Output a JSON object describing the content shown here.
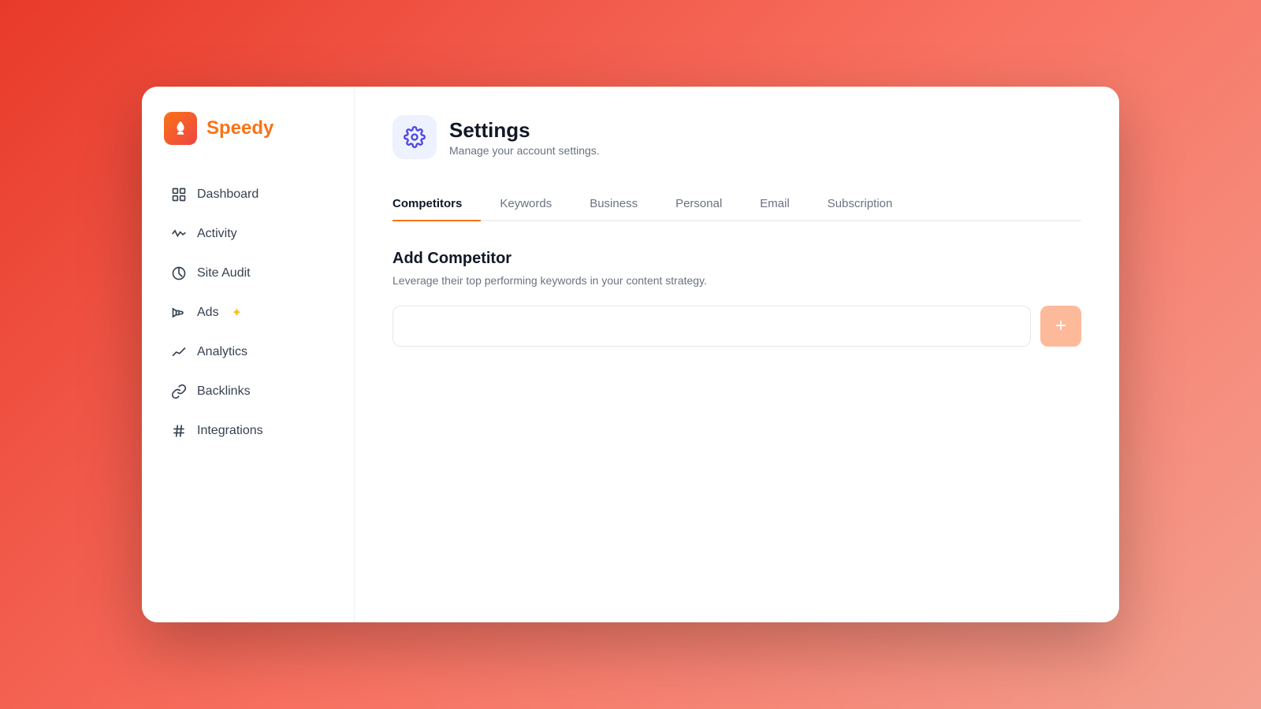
{
  "logo": {
    "icon_symbol": "🚀",
    "text": "Speedy"
  },
  "sidebar": {
    "items": [
      {
        "id": "dashboard",
        "label": "Dashboard",
        "icon": "dashboard"
      },
      {
        "id": "activity",
        "label": "Activity",
        "icon": "activity"
      },
      {
        "id": "site-audit",
        "label": "Site Audit",
        "icon": "site-audit"
      },
      {
        "id": "ads",
        "label": "Ads",
        "icon": "ads",
        "badge": "✦"
      },
      {
        "id": "analytics",
        "label": "Analytics",
        "icon": "analytics"
      },
      {
        "id": "backlinks",
        "label": "Backlinks",
        "icon": "backlinks"
      },
      {
        "id": "integrations",
        "label": "Integrations",
        "icon": "integrations"
      }
    ]
  },
  "header": {
    "title": "Settings",
    "subtitle": "Manage your account settings."
  },
  "tabs": [
    {
      "id": "competitors",
      "label": "Competitors",
      "active": true
    },
    {
      "id": "keywords",
      "label": "Keywords",
      "active": false
    },
    {
      "id": "business",
      "label": "Business",
      "active": false
    },
    {
      "id": "personal",
      "label": "Personal",
      "active": false
    },
    {
      "id": "email",
      "label": "Email",
      "active": false
    },
    {
      "id": "subscription",
      "label": "Subscription",
      "active": false
    }
  ],
  "competitor_section": {
    "title": "Add Competitor",
    "description": "Leverage their top performing keywords in your content strategy.",
    "input_placeholder": "",
    "add_button_label": "+"
  },
  "colors": {
    "brand_orange": "#f97316",
    "tab_active_border": "#f97316",
    "add_btn_bg": "#fdba9a",
    "header_icon_bg": "#eef2ff",
    "header_icon_color": "#4f46e5"
  }
}
